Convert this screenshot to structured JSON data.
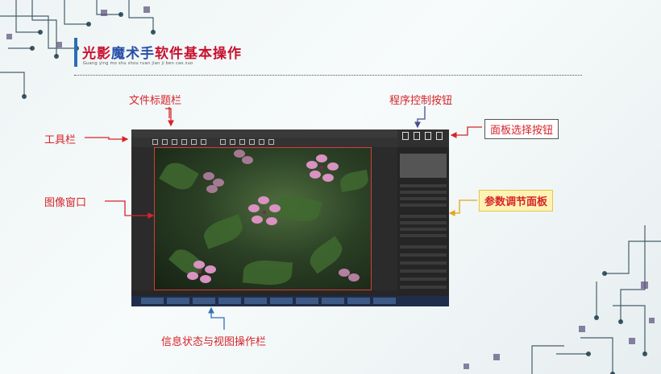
{
  "slide": {
    "title_part1": "光影",
    "title_part2": "魔术手",
    "title_part3": "软件基本操作",
    "subtitle": "Guang ying mo shu shou ruan jian ji ben cao zuo"
  },
  "annotations": {
    "file_title_bar": "文件标题栏",
    "program_control_buttons": "程序控制按钮",
    "toolbar": "工具栏",
    "panel_select_buttons": "面板选择按钮",
    "image_window": "图像窗口",
    "param_panel": "参数调节面板",
    "status_view_bar": "信息状态与视图操作栏"
  },
  "colors": {
    "label_red": "#d6242a",
    "accent_blue": "#2d6db5",
    "highlight_yellow": "#fff3b3"
  }
}
